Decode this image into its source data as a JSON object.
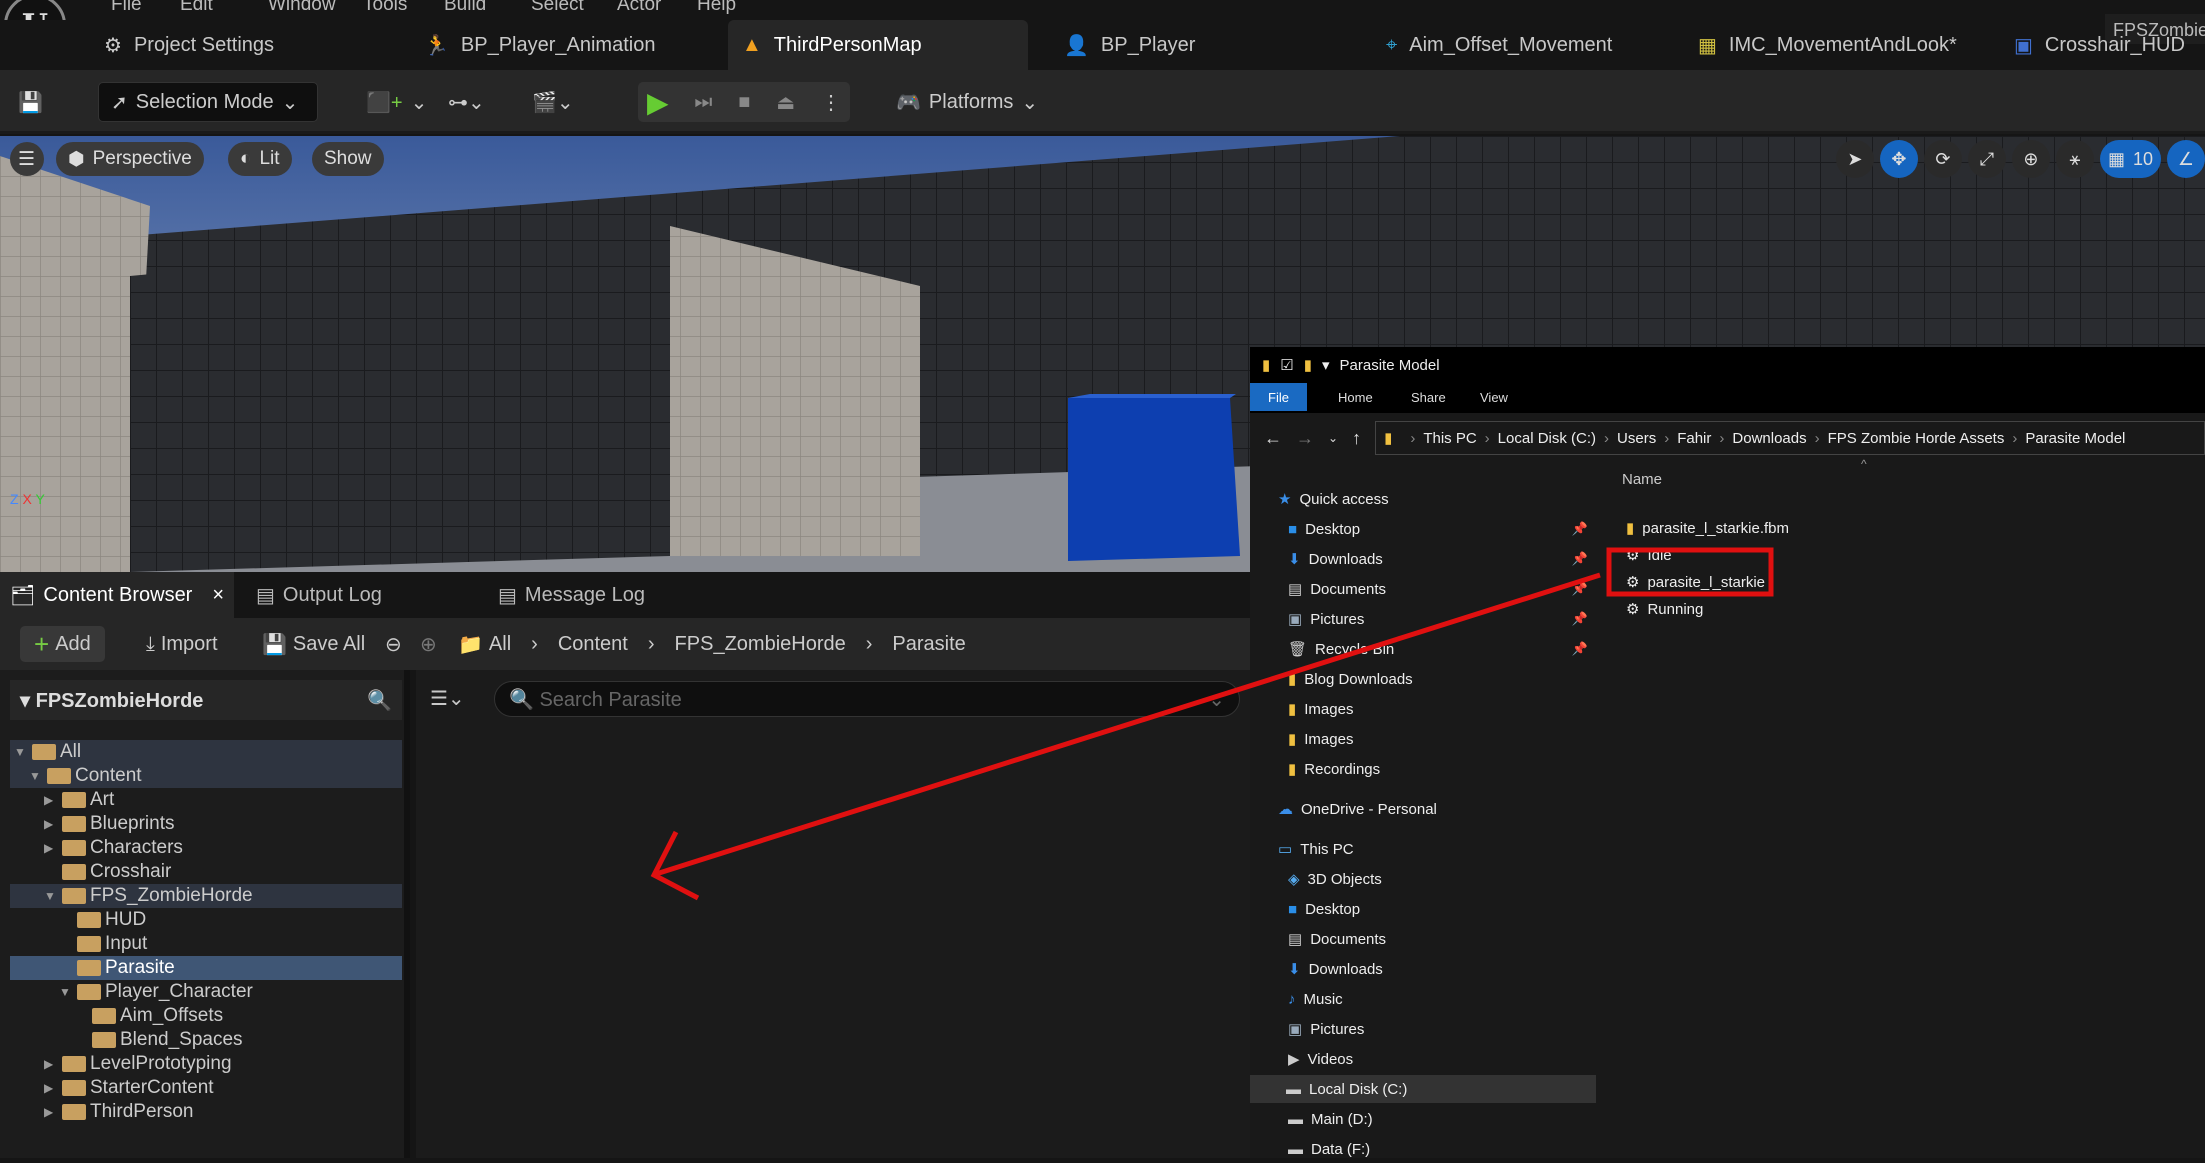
{
  "menu": [
    "File",
    "Edit",
    "Window",
    "Tools",
    "Build",
    "Select",
    "Actor",
    "Help"
  ],
  "project_name": "FPSZombieHorde",
  "tabs": [
    {
      "label": "Project Settings",
      "icon": "gear-icon"
    },
    {
      "label": "BP_Player_Animation",
      "icon": "running-man-icon"
    },
    {
      "label": "ThirdPersonMap",
      "icon": "level-icon",
      "active": true
    },
    {
      "label": "BP_Player",
      "icon": "pawn-icon"
    },
    {
      "label": "Aim_Offset_Movement",
      "icon": "aim-offset-icon"
    },
    {
      "label": "IMC_MovementAndLook*",
      "icon": "input-mapping-icon"
    },
    {
      "label": "Crosshair_HUD",
      "icon": "widget-icon"
    }
  ],
  "toolbar": {
    "selection_mode": "Selection Mode",
    "platforms": "Platforms"
  },
  "viewport": {
    "perspective": "Perspective",
    "lit": "Lit",
    "show": "Show",
    "grid_snap": "10",
    "axis_z": "Z",
    "axis_x": "X",
    "axis_y": "Y"
  },
  "content_tabs": [
    {
      "label": "Content Browser",
      "active": true
    },
    {
      "label": "Output Log"
    },
    {
      "label": "Message Log"
    }
  ],
  "cb_toolbar": {
    "add": "Add",
    "import": "Import",
    "save_all": "Save All"
  },
  "breadcrumb": [
    "All",
    "Content",
    "FPS_ZombieHorde",
    "Parasite"
  ],
  "tree_root": "FPSZombieHorde",
  "tree": [
    {
      "label": "All",
      "depth": 0,
      "open": true
    },
    {
      "label": "Content",
      "depth": 1,
      "open": true
    },
    {
      "label": "Art",
      "depth": 2,
      "collapsed": true
    },
    {
      "label": "Blueprints",
      "depth": 2,
      "collapsed": true
    },
    {
      "label": "Characters",
      "depth": 2,
      "collapsed": true
    },
    {
      "label": "Crosshair",
      "depth": 2
    },
    {
      "label": "FPS_ZombieHorde",
      "depth": 2,
      "open": true
    },
    {
      "label": "HUD",
      "depth": 3
    },
    {
      "label": "Input",
      "depth": 3
    },
    {
      "label": "Parasite",
      "depth": 3,
      "selected": true
    },
    {
      "label": "Player_Character",
      "depth": 3,
      "open": true
    },
    {
      "label": "Aim_Offsets",
      "depth": 4
    },
    {
      "label": "Blend_Spaces",
      "depth": 4
    },
    {
      "label": "LevelPrototyping",
      "depth": 2,
      "collapsed": true
    },
    {
      "label": "StarterContent",
      "depth": 2,
      "collapsed": true
    },
    {
      "label": "ThirdPerson",
      "depth": 2,
      "collapsed": true
    }
  ],
  "search": {
    "placeholder": "Search Parasite"
  },
  "explorer": {
    "title": "Parasite Model",
    "ribbon": [
      "File",
      "Home",
      "Share",
      "View"
    ],
    "address": [
      "This PC",
      "Local Disk (C:)",
      "Users",
      "Fahir",
      "Downloads",
      "FPS Zombie Horde Assets",
      "Parasite Model"
    ],
    "column_name": "Name",
    "nav": [
      {
        "label": "Quick access",
        "icon": "star-icon",
        "top": true
      },
      {
        "label": "Desktop",
        "icon": "desktop-icon",
        "pinned": true
      },
      {
        "label": "Downloads",
        "icon": "download-icon",
        "pinned": true
      },
      {
        "label": "Documents",
        "icon": "document-icon",
        "pinned": true
      },
      {
        "label": "Pictures",
        "icon": "pictures-icon",
        "pinned": true
      },
      {
        "label": "Recycle Bin",
        "icon": "recycle-bin-icon",
        "pinned": true
      },
      {
        "label": "Blog Downloads",
        "icon": "folder-icon"
      },
      {
        "label": "Images",
        "icon": "folder-icon"
      },
      {
        "label": "Images",
        "icon": "folder-icon"
      },
      {
        "label": "Recordings",
        "icon": "folder-icon"
      },
      {
        "label": "OneDrive - Personal",
        "icon": "cloud-icon",
        "top": true
      },
      {
        "label": "This PC",
        "icon": "pc-icon",
        "top": true
      },
      {
        "label": "3D Objects",
        "icon": "3d-objects-icon"
      },
      {
        "label": "Desktop",
        "icon": "desktop-icon"
      },
      {
        "label": "Documents",
        "icon": "document-icon"
      },
      {
        "label": "Downloads",
        "icon": "download-icon"
      },
      {
        "label": "Music",
        "icon": "music-icon"
      },
      {
        "label": "Pictures",
        "icon": "pictures-icon"
      },
      {
        "label": "Videos",
        "icon": "videos-icon"
      },
      {
        "label": "Local Disk (C:)",
        "icon": "drive-icon",
        "selected": true
      },
      {
        "label": "Main (D:)",
        "icon": "drive-icon"
      },
      {
        "label": "Data (F:)",
        "icon": "drive-icon"
      }
    ],
    "files": [
      {
        "label": "parasite_l_starkie.fbm",
        "icon": "folder-icon"
      },
      {
        "label": "Idle",
        "icon": "fbx-file-icon"
      },
      {
        "label": "parasite_l_starkie",
        "icon": "fbx-file-icon",
        "highlighted": true
      },
      {
        "label": "Running",
        "icon": "fbx-file-icon"
      }
    ]
  },
  "annotation_color": "#e01010"
}
